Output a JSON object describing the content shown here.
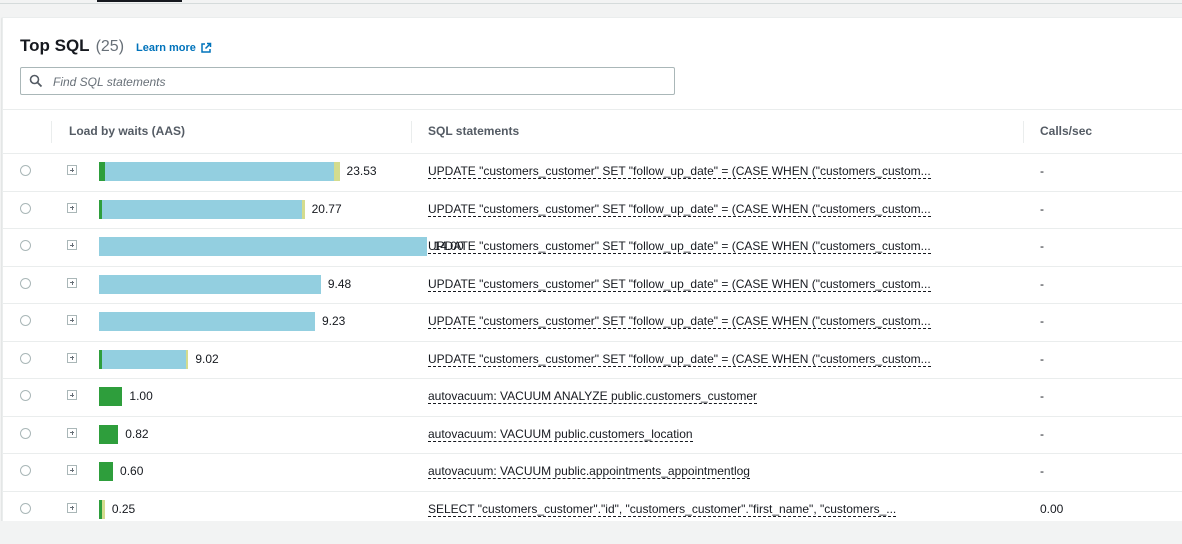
{
  "colors": {
    "cpu": "#2e9e3c",
    "io": "#93cfe0",
    "other": "#d4dc8e",
    "link": "#0073bb"
  },
  "header": {
    "title": "Top SQL",
    "count": "(25)",
    "learn_more": "Learn more"
  },
  "search": {
    "placeholder": "Find SQL statements"
  },
  "columns": {
    "load": "Load by waits (AAS)",
    "sql": "SQL statements",
    "calls": "Calls/sec"
  },
  "rows": [
    {
      "load": "23.53",
      "segments": [
        0.26,
        9.8,
        0.22
      ],
      "sql": "UPDATE \"customers_customer\" SET \"follow_up_date\" = (CASE WHEN (\"customers_custom...",
      "calls": "-"
    },
    {
      "load": "20.77",
      "segments": [
        0.1,
        8.55,
        0.13
      ],
      "sql": "UPDATE \"customers_customer\" SET \"follow_up_date\" = (CASE WHEN (\"customers_custom...",
      "calls": "-"
    },
    {
      "load": "14.00",
      "segments": [
        0,
        14.0,
        0
      ],
      "sql": "UPDATE \"customers_customer\" SET \"follow_up_date\" = (CASE WHEN (\"customers_custom...",
      "calls": "-"
    },
    {
      "load": "9.48",
      "segments": [
        0,
        9.48,
        0
      ],
      "sql": "UPDATE \"customers_customer\" SET \"follow_up_date\" = (CASE WHEN (\"customers_custom...",
      "calls": "-"
    },
    {
      "load": "9.23",
      "segments": [
        0,
        9.23,
        0
      ],
      "sql": "UPDATE \"customers_customer\" SET \"follow_up_date\" = (CASE WHEN (\"customers_custom...",
      "calls": "-"
    },
    {
      "load": "9.02",
      "segments": [
        0.12,
        3.58,
        0.12
      ],
      "sql": "UPDATE \"customers_customer\" SET \"follow_up_date\" = (CASE WHEN (\"customers_custom...",
      "calls": "-"
    },
    {
      "load": "1.00",
      "segments": [
        1.0,
        0,
        0
      ],
      "sql": "autovacuum: VACUUM ANALYZE public.customers_customer",
      "calls": "-"
    },
    {
      "load": "0.82",
      "segments": [
        0.82,
        0,
        0
      ],
      "sql": "autovacuum: VACUUM public.customers_location",
      "calls": "-"
    },
    {
      "load": "0.60",
      "segments": [
        0.6,
        0,
        0
      ],
      "sql": "autovacuum: VACUUM public.appointments_appointmentlog",
      "calls": "-"
    },
    {
      "load": "0.25",
      "segments": [
        0.13,
        0,
        0.12
      ],
      "sql": "SELECT \"customers_customer\".\"id\", \"customers_customer\".\"first_name\", \"customers_...",
      "calls": "0.00"
    }
  ]
}
